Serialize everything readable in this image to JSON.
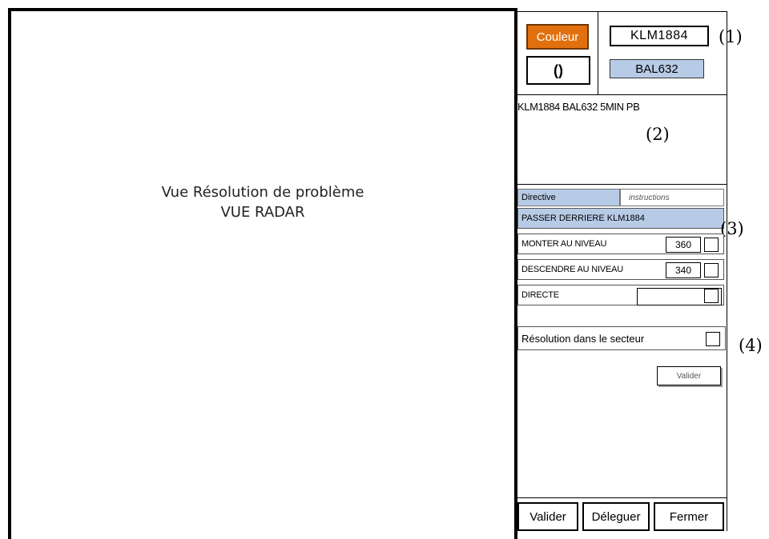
{
  "radar": {
    "line1": "Vue Résolution de problème",
    "line2": "VUE RADAR"
  },
  "section1": {
    "couleur_label": "Couleur",
    "paren_label": "()",
    "callsign_1": "KLM1884",
    "callsign_2": "BAL632",
    "annotation": "(1)"
  },
  "section2": {
    "conflict_text": "KLM1884 BAL632 5MIN PB",
    "annotation": "(2)"
  },
  "section3": {
    "directive_label": "Directive",
    "directive_value": "instructions",
    "selected_directive": "PASSER DERRIERE KLM1884",
    "monter_label": "MONTER AU NIVEAU",
    "monter_level": "360",
    "descendre_label": "DESCENDRE AU NIVEAU",
    "descendre_level": "340",
    "directe_label": "DIRECTE",
    "annotation": "(3)"
  },
  "section4": {
    "resolution_label": "Résolution dans le secteur",
    "small_valider": "Valider",
    "annotation": "(4)"
  },
  "footer": {
    "valider": "Valider",
    "deleguer": "Déleguer",
    "fermer": "Fermer"
  },
  "colors": {
    "couleur_button": "#e2700e",
    "selected_blue": "#b7cbe6"
  }
}
